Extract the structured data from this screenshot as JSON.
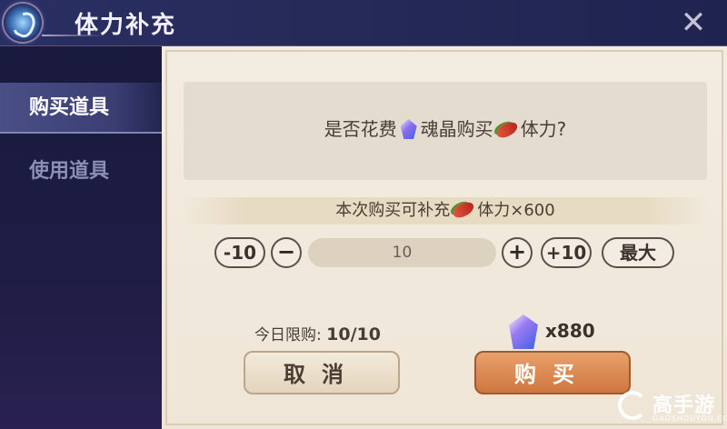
{
  "header": {
    "title": "体力补充",
    "close_icon": "close-icon"
  },
  "sidebar": {
    "items": [
      {
        "label": "购买道具",
        "active": true
      },
      {
        "label": "使用道具",
        "active": false
      }
    ]
  },
  "dialog": {
    "question_prefix": "是否花费",
    "question_currency": "魂晶购买",
    "question_suffix": "体力?",
    "refill_prefix": "本次购买可补充",
    "refill_suffix": "体力×600",
    "minus10_label": "-10",
    "minus_label": "−",
    "quantity": "10",
    "plus_label": "+",
    "plus10_label": "+10",
    "max_label": "最大",
    "limit_label": "今日限购:",
    "limit_value": "10/10",
    "cost_value": "x880",
    "cancel_label": "取消",
    "buy_label": "购买"
  },
  "watermark": {
    "brand": "高手游",
    "sub": "GAOSHOUYOU.COM"
  },
  "colors": {
    "sidebar_bg": "#1e1c45",
    "panel_bg": "#f3ece1",
    "buy_accent": "#cf7640"
  }
}
